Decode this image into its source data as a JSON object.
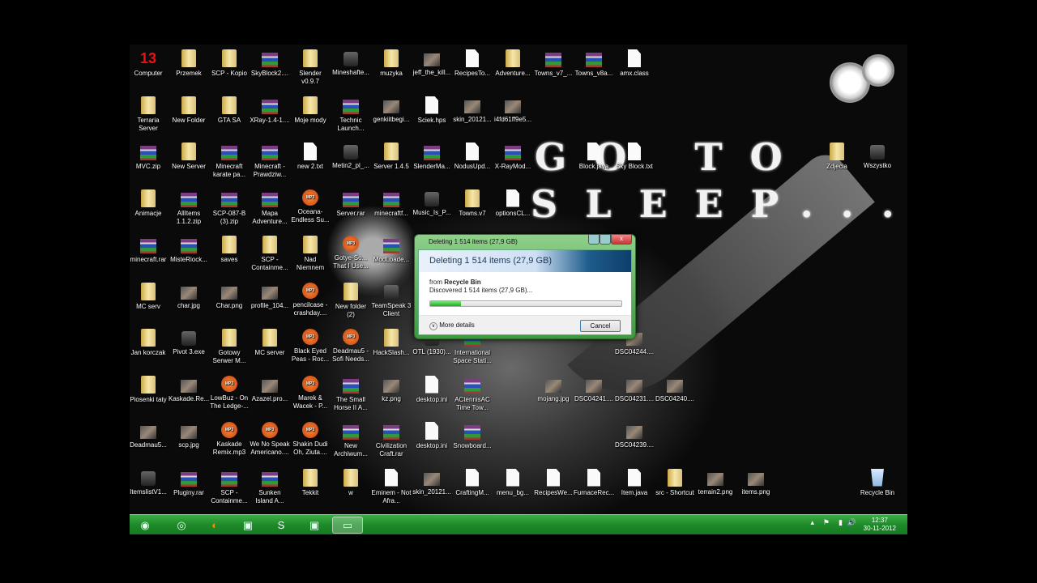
{
  "wallpaper": {
    "line1": "GO TO",
    "line2": "SLEEP..."
  },
  "desktop": {
    "icons": [
      {
        "label": "Computer",
        "icon": "computer",
        "glyph": "13"
      },
      {
        "label": "Przemek",
        "icon": "folder"
      },
      {
        "label": "SCP - Kopio",
        "icon": "folder"
      },
      {
        "label": "SkyBlock2....",
        "icon": "rar"
      },
      {
        "label": "Slender v0.9.7",
        "icon": "folder"
      },
      {
        "label": "Mineshafte...",
        "icon": "app"
      },
      {
        "label": "muzyka",
        "icon": "folder"
      },
      {
        "label": "jeff_the_kill...",
        "icon": "image"
      },
      {
        "label": "RecipesTo...",
        "icon": "file"
      },
      {
        "label": "Adventure...",
        "icon": "folder"
      },
      {
        "label": "Towns_v7_...",
        "icon": "rar"
      },
      {
        "label": "Towns_v8a...",
        "icon": "rar"
      },
      {
        "label": "amx.class",
        "icon": "file"
      },
      {
        "label": "Terraria Server",
        "icon": "folder"
      },
      {
        "label": "New Folder",
        "icon": "folder"
      },
      {
        "label": "GTA SA",
        "icon": "folder"
      },
      {
        "label": "XRay-1.4-1....",
        "icon": "rar"
      },
      {
        "label": "Moje mody",
        "icon": "folder"
      },
      {
        "label": "Technic Launch...",
        "icon": "rar"
      },
      {
        "label": "genkiitbegi...",
        "icon": "image"
      },
      {
        "label": "Sciek.hps",
        "icon": "file"
      },
      {
        "label": "skin_20121...",
        "icon": "image"
      },
      {
        "label": "i4fd61ff9e5...",
        "icon": "image"
      },
      {
        "label": "MVC.zip",
        "icon": "rar"
      },
      {
        "label": "New Server",
        "icon": "folder"
      },
      {
        "label": "Minecraft karate pa...",
        "icon": "rar"
      },
      {
        "label": "Minecraft - Prawdziw...",
        "icon": "rar"
      },
      {
        "label": "new 2.txt",
        "icon": "file"
      },
      {
        "label": "Metin2_pl_...",
        "icon": "app"
      },
      {
        "label": "Server 1.4.5",
        "icon": "folder"
      },
      {
        "label": "SlenderMa...",
        "icon": "rar"
      },
      {
        "label": "NodusUpd...",
        "icon": "file"
      },
      {
        "label": "X-RayMod...",
        "icon": "rar"
      },
      {
        "label": "Block.java",
        "icon": "file"
      },
      {
        "label": "Sky Block.txt",
        "icon": "file"
      },
      {
        "label": "Zdjecia",
        "icon": "folder"
      },
      {
        "label": "Wszystko",
        "icon": "app"
      },
      {
        "label": "Animacje",
        "icon": "folder"
      },
      {
        "label": "AllItems 1.1.2.zip",
        "icon": "rar"
      },
      {
        "label": "SCP-087-B (3).zip",
        "icon": "rar"
      },
      {
        "label": "Mapa Adventure...",
        "icon": "rar"
      },
      {
        "label": "Oceana- Endless Su...",
        "icon": "mp3"
      },
      {
        "label": "Server.rar",
        "icon": "rar"
      },
      {
        "label": "minecraftf...",
        "icon": "rar"
      },
      {
        "label": "Music_Is_P...",
        "icon": "app"
      },
      {
        "label": "Towns.v7",
        "icon": "folder"
      },
      {
        "label": "optionsCL...",
        "icon": "file"
      },
      {
        "label": "minecraft.rar",
        "icon": "rar"
      },
      {
        "label": "MisteRiock...",
        "icon": "rar"
      },
      {
        "label": "saves",
        "icon": "folder"
      },
      {
        "label": "SCP - Containme...",
        "icon": "folder"
      },
      {
        "label": "Nad Niemnem",
        "icon": "folder"
      },
      {
        "label": "Gotye-So... That I Use...",
        "icon": "mp3"
      },
      {
        "label": "ModLoade...",
        "icon": "rar"
      },
      {
        "label": "MC serv",
        "icon": "folder"
      },
      {
        "label": "char.jpg",
        "icon": "image"
      },
      {
        "label": "Char.png",
        "icon": "image"
      },
      {
        "label": "profile_104...",
        "icon": "image"
      },
      {
        "label": "pencilcase - crashday....",
        "icon": "mp3"
      },
      {
        "label": "New folder (2)",
        "icon": "folder"
      },
      {
        "label": "TeamSpeak 3 Client",
        "icon": "app"
      },
      {
        "label": "Jan korczak",
        "icon": "folder"
      },
      {
        "label": "Pivot 3.exe",
        "icon": "app"
      },
      {
        "label": "Gotowy Serwer M...",
        "icon": "folder"
      },
      {
        "label": "MC server",
        "icon": "folder"
      },
      {
        "label": "Black Eyed Peas - Roc...",
        "icon": "mp3"
      },
      {
        "label": "Deadmau5 - Sofi Needs...",
        "icon": "mp3"
      },
      {
        "label": "HackSlash...",
        "icon": "folder"
      },
      {
        "label": "OTL (1930)...",
        "icon": "app"
      },
      {
        "label": "International Space Stati...",
        "icon": "rar"
      },
      {
        "label": "DSC04244....",
        "icon": "image"
      },
      {
        "label": "Piosenki taty",
        "icon": "folder"
      },
      {
        "label": "Kaskade.Re...",
        "icon": "image"
      },
      {
        "label": "LowBuz - On The Ledge-...",
        "icon": "mp3"
      },
      {
        "label": "Azazel.pro...",
        "icon": "image"
      },
      {
        "label": "Marek & Wacek - P...",
        "icon": "mp3"
      },
      {
        "label": "The Small Horse II A...",
        "icon": "rar"
      },
      {
        "label": "kz.png",
        "icon": "image"
      },
      {
        "label": "desktop.ini",
        "icon": "file"
      },
      {
        "label": "ACtennisAC Time Tow...",
        "icon": "rar"
      },
      {
        "label": "mojang.jpg",
        "icon": "image"
      },
      {
        "label": "DSC04241....",
        "icon": "image"
      },
      {
        "label": "DSC04231....",
        "icon": "image"
      },
      {
        "label": "DSC04240....",
        "icon": "image"
      },
      {
        "label": "Deadmau5...",
        "icon": "image"
      },
      {
        "label": "scp.jpg",
        "icon": "image"
      },
      {
        "label": "Kaskade Remix.mp3",
        "icon": "mp3"
      },
      {
        "label": "We No Speak Americano....",
        "icon": "mp3"
      },
      {
        "label": "Shakin Dudi Oh, Ziuta....",
        "icon": "mp3"
      },
      {
        "label": "New Archiwum...",
        "icon": "rar"
      },
      {
        "label": "Civilization Craft.rar",
        "icon": "rar"
      },
      {
        "label": "desktop.ini",
        "icon": "file"
      },
      {
        "label": "Snowboard...",
        "icon": "rar"
      },
      {
        "label": "DSC04239....",
        "icon": "image"
      },
      {
        "label": "ItemslistV1...",
        "icon": "app"
      },
      {
        "label": "Pluginy.rar",
        "icon": "rar"
      },
      {
        "label": "SCP - Containme...",
        "icon": "rar"
      },
      {
        "label": "Sunken Island A...",
        "icon": "rar"
      },
      {
        "label": "Tekkit",
        "icon": "folder"
      },
      {
        "label": "w",
        "icon": "folder"
      },
      {
        "label": "Eminem - Not Afra...",
        "icon": "file"
      },
      {
        "label": "skin_20121...",
        "icon": "image"
      },
      {
        "label": "CraftingM...",
        "icon": "file"
      },
      {
        "label": "menu_bg...",
        "icon": "file"
      },
      {
        "label": "RecipesWe...",
        "icon": "file"
      },
      {
        "label": "FurnaceRec...",
        "icon": "file"
      },
      {
        "label": "Item.java",
        "icon": "file"
      },
      {
        "label": "src - Shortcut",
        "icon": "folder"
      },
      {
        "label": "terrain2.png",
        "icon": "image"
      },
      {
        "label": "items.png",
        "icon": "image"
      },
      {
        "label": "Recycle Bin",
        "icon": "recycle"
      }
    ]
  },
  "dialog": {
    "title": "Deleting 1 514 items (27,9 GB)",
    "heading": "Deleting 1 514 items (27,9 GB)",
    "from_label": "from",
    "from_location": "Recycle Bin",
    "status": "Discovered 1 514 items (27,9 GB)...",
    "progress_percent": 16,
    "more_details": "More details",
    "cancel": "Cancel",
    "close": "x"
  },
  "taskbar": {
    "apps": [
      "start-orb",
      "chrome",
      "firefox",
      "app",
      "skype",
      "app",
      "windows-explorer"
    ],
    "active": "windows-explorer",
    "tray": {
      "time": "12:37",
      "date": "30-11-2012"
    }
  },
  "colors": {
    "taskbar": "#1f8a2a",
    "progress": "#17b317"
  }
}
